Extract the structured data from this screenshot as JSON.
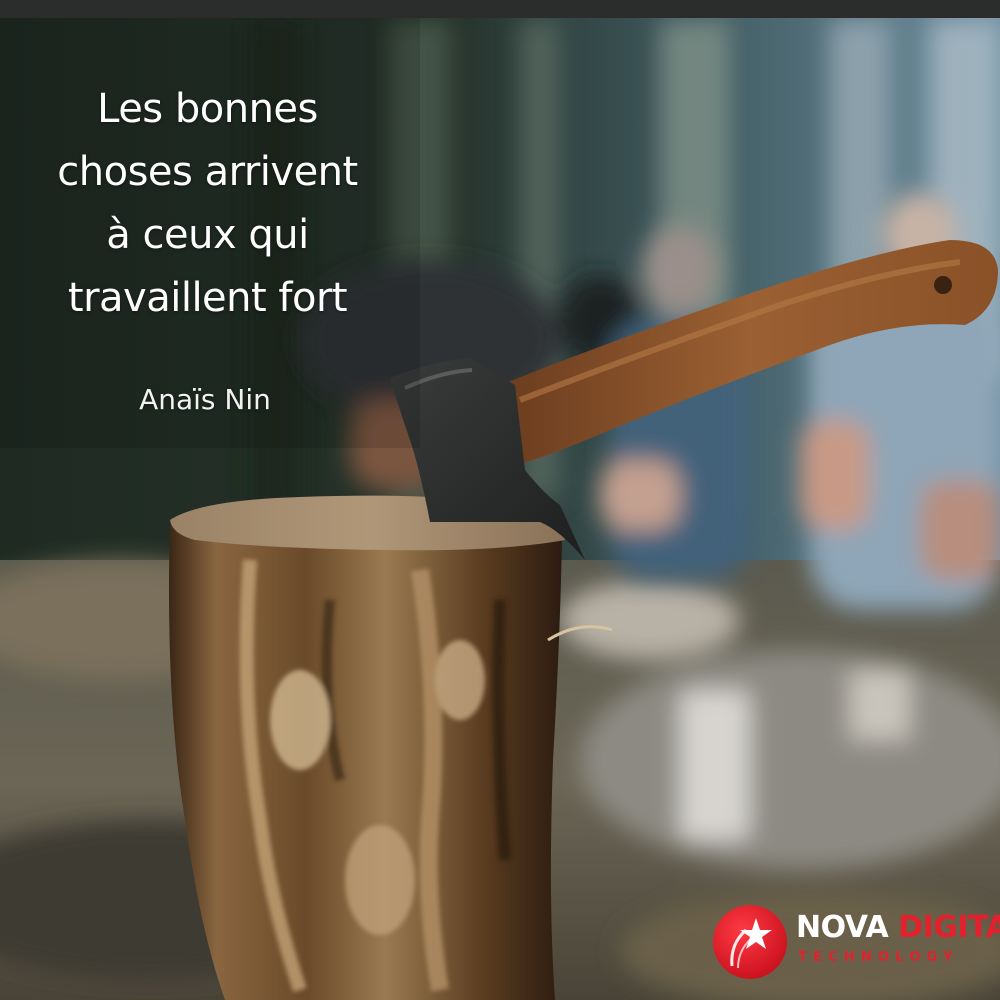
{
  "image": {
    "description_colors": {
      "forest_dark": "#1f2a22",
      "mist_blue": "#7f9aac",
      "stump_brown": "#6e4b2c",
      "handle_wood": "#8a5530",
      "axe_steel": "#2f3232"
    }
  },
  "quote": {
    "lines": [
      "Les bonnes",
      "choses arrivent",
      "à ceux qui",
      "travaillent fort"
    ]
  },
  "author": "Anaïs Nin",
  "logo": {
    "word1": "NOVA",
    "word2": "DIGITAL",
    "tagline": "TECHNOLOGY",
    "brand_red": "#e3202c",
    "mark_icon": "shooting-star-icon"
  }
}
